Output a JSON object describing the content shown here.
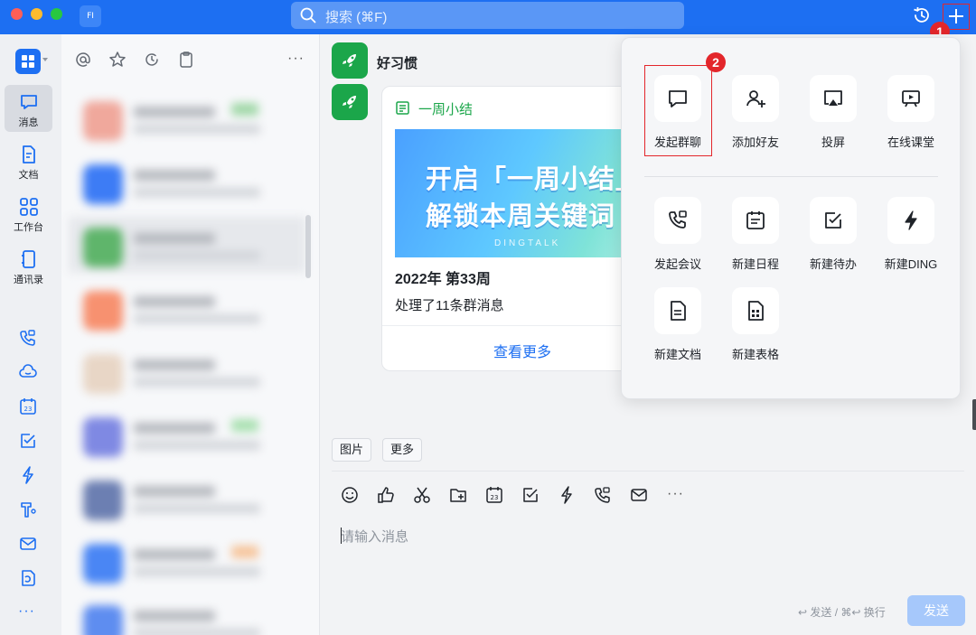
{
  "titlebar": {
    "app_badge": "FI",
    "search_placeholder": "搜索 (⌘F)",
    "marker_1": "1",
    "icons": [
      "history-icon",
      "plus-icon"
    ]
  },
  "leftnav": {
    "items": [
      {
        "label": "消息",
        "icon": "message-icon",
        "active": true
      },
      {
        "label": "文档",
        "icon": "document-icon"
      },
      {
        "label": "工作台",
        "icon": "workbench-icon"
      },
      {
        "label": "通讯录",
        "icon": "contacts-icon"
      }
    ],
    "shortcuts": [
      "phone-video-icon",
      "cloud-icon",
      "calendar-icon",
      "todo-icon",
      "ding-icon",
      "tools-icon",
      "mail-icon",
      "docs-icon"
    ],
    "calendar_day": "23",
    "more": "···"
  },
  "convlist": {
    "more": "···",
    "tab_icons": [
      "at-icon",
      "star-icon",
      "recent-icon",
      "clipboard-icon"
    ]
  },
  "chat": {
    "title": "好习惯",
    "card": {
      "header": "一周小结",
      "banner_line1": "开启「一周小结」",
      "banner_line2": "解锁本周关键词",
      "banner_brand": "DINGTALK",
      "week": "2022年 第33周",
      "desc": "处理了11条群消息",
      "more_link": "查看更多"
    },
    "quick_replies": [
      "图片",
      "更多"
    ],
    "toolbar_icons": [
      "emoji-icon",
      "thumbs-up-icon",
      "scissors-icon",
      "folder-add-icon",
      "calendar-icon",
      "todo-icon",
      "ding-icon",
      "phone-video-icon",
      "mail-icon"
    ],
    "toolbar_calendar_day": "23",
    "toolbar_more": "···",
    "input_placeholder": "请输入消息",
    "send_hint": "↩ 发送 / ⌘↩ 换行",
    "send_label": "发送"
  },
  "popup": {
    "marker_2": "2",
    "actions_top": [
      {
        "label": "发起群聊",
        "icon": "group-chat-icon"
      },
      {
        "label": "添加好友",
        "icon": "add-friend-icon"
      },
      {
        "label": "投屏",
        "icon": "screen-cast-icon"
      },
      {
        "label": "在线课堂",
        "icon": "online-class-icon"
      }
    ],
    "actions_bottom": [
      {
        "label": "发起会议",
        "icon": "meeting-icon"
      },
      {
        "label": "新建日程",
        "icon": "new-schedule-icon"
      },
      {
        "label": "新建待办",
        "icon": "new-todo-icon"
      },
      {
        "label": "新建DING",
        "icon": "new-ding-icon"
      },
      {
        "label": "新建文档",
        "icon": "new-document-icon"
      },
      {
        "label": "新建表格",
        "icon": "new-sheet-icon"
      }
    ]
  },
  "colors": {
    "brand_blue": "#1d6ff2",
    "annotation_red": "#e3262b",
    "robot_green": "#1ba64a"
  }
}
